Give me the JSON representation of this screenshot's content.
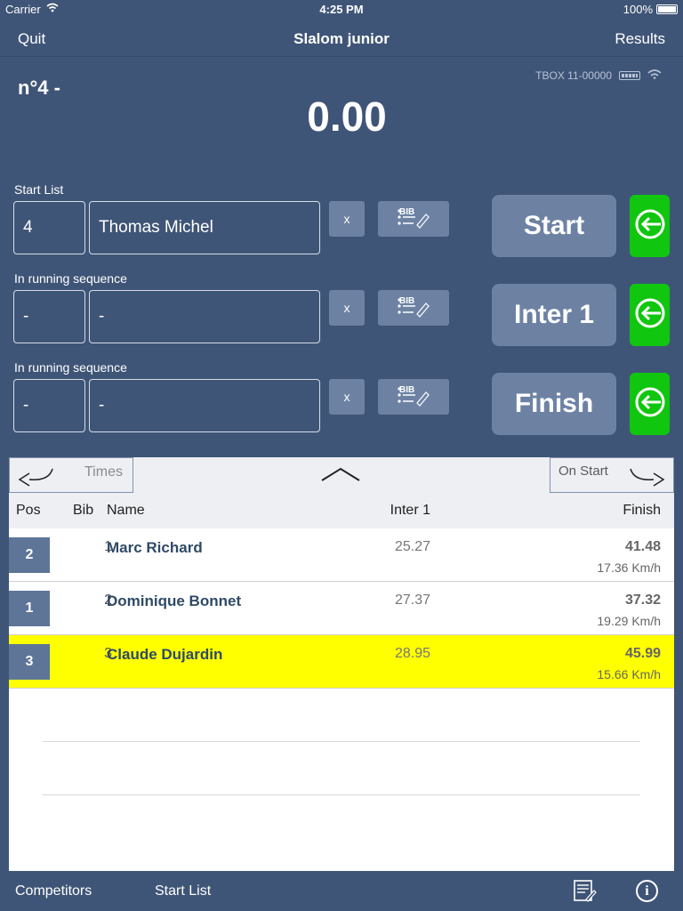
{
  "status_bar": {
    "carrier": "Carrier",
    "time": "4:25 PM",
    "battery": "100%"
  },
  "nav": {
    "left": "Quit",
    "title": "Slalom junior",
    "right": "Results"
  },
  "run_number": "n°4 -",
  "device": {
    "id": "TBOX 11-00000"
  },
  "timer": "0.00",
  "rows": [
    {
      "label": "Start List",
      "bib": "4",
      "name": "Thomas Michel",
      "clear": "x",
      "bib_btn": "BIB",
      "action": "Start"
    },
    {
      "label": "In running sequence",
      "bib": "-",
      "name": "-",
      "clear": "x",
      "bib_btn": "BIB",
      "action": "Inter 1"
    },
    {
      "label": "In running sequence",
      "bib": "-",
      "name": "-",
      "clear": "x",
      "bib_btn": "BIB",
      "action": "Finish"
    }
  ],
  "tabs": {
    "left": "Times",
    "right": "On Start"
  },
  "table": {
    "headers": {
      "pos": "Pos",
      "bib": "Bib",
      "name": "Name",
      "inter": "Inter 1",
      "finish": "Finish"
    },
    "rows": [
      {
        "pos": "2",
        "bib": "1",
        "name": "Marc Richard",
        "inter": "25.27",
        "finish": "41.48",
        "speed": "17.36 Km/h",
        "highlight": false
      },
      {
        "pos": "1",
        "bib": "2",
        "name": "Dominique Bonnet",
        "inter": "27.37",
        "finish": "37.32",
        "speed": "19.29 Km/h",
        "highlight": false
      },
      {
        "pos": "3",
        "bib": "3",
        "name": "Claude Dujardin",
        "inter": "28.95",
        "finish": "45.99",
        "speed": "15.66 Km/h",
        "highlight": true
      }
    ]
  },
  "bottom": {
    "competitors": "Competitors",
    "start_list": "Start List",
    "info": "i"
  },
  "colors": {
    "background": "#3f5577",
    "button": "#6d82a3",
    "go": "#10c60e",
    "highlight": "#ffff00"
  }
}
